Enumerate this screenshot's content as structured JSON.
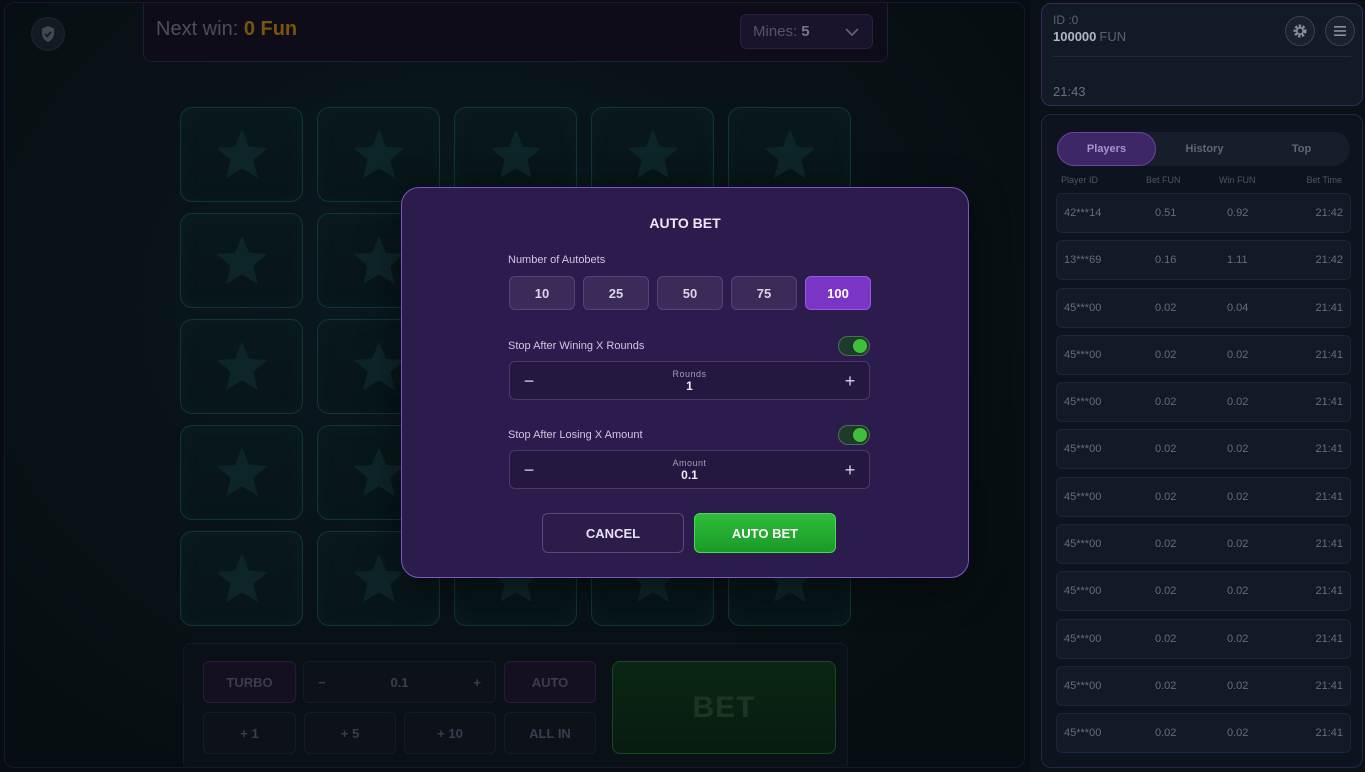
{
  "header": {
    "next_win_label": "Next win:",
    "next_win_value": "0 Fun",
    "mines_label": "Mines:",
    "mines_value": "5"
  },
  "grid": {
    "rows": 5,
    "cols": 5,
    "tile_icon": "star-icon"
  },
  "controls": {
    "turbo": "TURBO",
    "amount": "0.1",
    "auto": "AUTO",
    "plus_1": "+ 1",
    "plus_5": "+ 5",
    "plus_10": "+ 10",
    "all_in": "ALL IN",
    "bet": "BET"
  },
  "account": {
    "id": "ID :0",
    "balance": "100000",
    "currency": "FUN",
    "time": "21:43"
  },
  "players": {
    "tabs": [
      "Players",
      "History",
      "Top"
    ],
    "columns": [
      "Player ID",
      "Bet  FUN",
      "Win  FUN",
      "Bet Time"
    ],
    "rows": [
      {
        "id": "42***14",
        "bet": "0.51",
        "win": "0.92",
        "time": "21:42"
      },
      {
        "id": "13***69",
        "bet": "0.16",
        "win": "1.11",
        "time": "21:42"
      },
      {
        "id": "45***00",
        "bet": "0.02",
        "win": "0.04",
        "time": "21:41"
      },
      {
        "id": "45***00",
        "bet": "0.02",
        "win": "0.02",
        "time": "21:41"
      },
      {
        "id": "45***00",
        "bet": "0.02",
        "win": "0.02",
        "time": "21:41"
      },
      {
        "id": "45***00",
        "bet": "0.02",
        "win": "0.02",
        "time": "21:41"
      },
      {
        "id": "45***00",
        "bet": "0.02",
        "win": "0.02",
        "time": "21:41"
      },
      {
        "id": "45***00",
        "bet": "0.02",
        "win": "0.02",
        "time": "21:41"
      },
      {
        "id": "45***00",
        "bet": "0.02",
        "win": "0.02",
        "time": "21:41"
      },
      {
        "id": "45***00",
        "bet": "0.02",
        "win": "0.02",
        "time": "21:41"
      },
      {
        "id": "45***00",
        "bet": "0.02",
        "win": "0.02",
        "time": "21:41"
      },
      {
        "id": "45***00",
        "bet": "0.02",
        "win": "0.02",
        "time": "21:41"
      }
    ]
  },
  "modal": {
    "title": "AUTO BET",
    "autobets_label": "Number of Autobets",
    "autobet_options": [
      "10",
      "25",
      "50",
      "75",
      "100"
    ],
    "autobet_selected": "100",
    "stop_win_label": "Stop After Wining X Rounds",
    "stop_win_enabled": true,
    "rounds_caption": "Rounds",
    "rounds_value": "1",
    "stop_loss_label": "Stop After Losing X Amount",
    "stop_loss_enabled": true,
    "amount_caption": "Amount",
    "amount_value": "0.1",
    "minus": "−",
    "plus": "+",
    "cancel": "CANCEL",
    "confirm": "AUTO BET"
  },
  "colors": {
    "accent_purple": "#7b35c6",
    "accent_green": "#2ebd3a",
    "win_gold": "#d8920e"
  }
}
